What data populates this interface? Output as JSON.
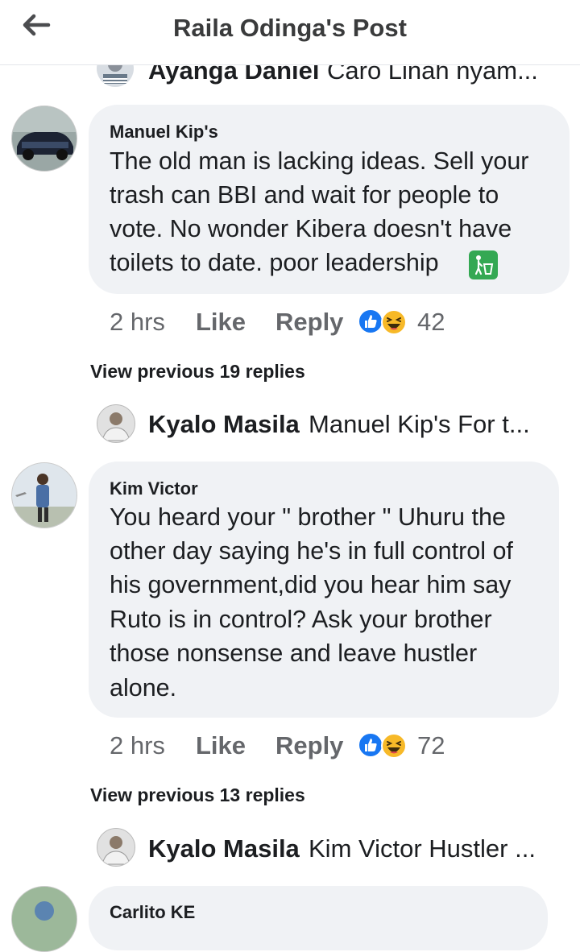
{
  "header": {
    "title": "Raila Odinga's Post"
  },
  "partial_top_reply": {
    "name": "Ayanga Daniel",
    "text": "Caro Linah nyam..."
  },
  "comments": [
    {
      "author": "Manuel Kip's",
      "lines": [
        "The old man is lacking ideas. Sell your",
        "trash can BBI and wait for people to",
        "vote. No wonder Kibera doesn't have",
        "toilets to date. poor leadership"
      ],
      "time": "2 hrs",
      "like": "Like",
      "reply": "Reply",
      "reaction_count": "42",
      "view_previous": "View previous 19 replies",
      "latest_reply": {
        "name": "Kyalo Masila",
        "text": "Manuel Kip's For t..."
      }
    },
    {
      "author": "Kim Victor",
      "lines": [
        "You heard your \" brother \" Uhuru the",
        "other day saying he's in full control of",
        "his government,did you hear him say",
        "Ruto is in control? Ask your brother",
        "those nonsense and leave hustler",
        "alone."
      ],
      "time": "2 hrs",
      "like": "Like",
      "reply": "Reply",
      "reaction_count": "72",
      "view_previous": "View previous 13 replies",
      "latest_reply": {
        "name": "Kyalo Masila",
        "text": "Kim Victor Hustler ..."
      }
    },
    {
      "author": "Carlito KE"
    }
  ],
  "colors": {
    "like_blue": "#1877f2",
    "haha_yellow": "#f7b928",
    "bubble_bg": "#f0f2f5",
    "meta_gray": "#65676b"
  },
  "icons": [
    "back-arrow-icon",
    "like-reaction-icon",
    "haha-reaction-icon",
    "litter-bin-emoji-icon"
  ]
}
